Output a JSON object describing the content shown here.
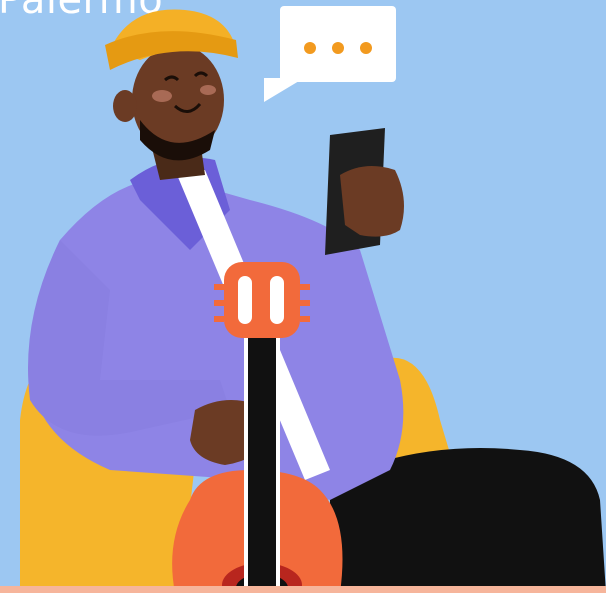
{
  "caption": {
    "text": "Palermo"
  },
  "colors": {
    "background": "#9cc7f2",
    "hat": "#f4b026",
    "skin": "#6b3b24",
    "jacket": "#8e84e6",
    "jacket_dark": "#6b5fd8",
    "pants": "#111111",
    "seat": "#f5b52b",
    "guitar": "#f26a3b",
    "phone": "#1f1f1f",
    "bubble_dots": "#f29a1f",
    "bottom_strip": "#f6b59b"
  },
  "icons": [
    "speech-bubble-icon",
    "typing-dots-icon"
  ]
}
